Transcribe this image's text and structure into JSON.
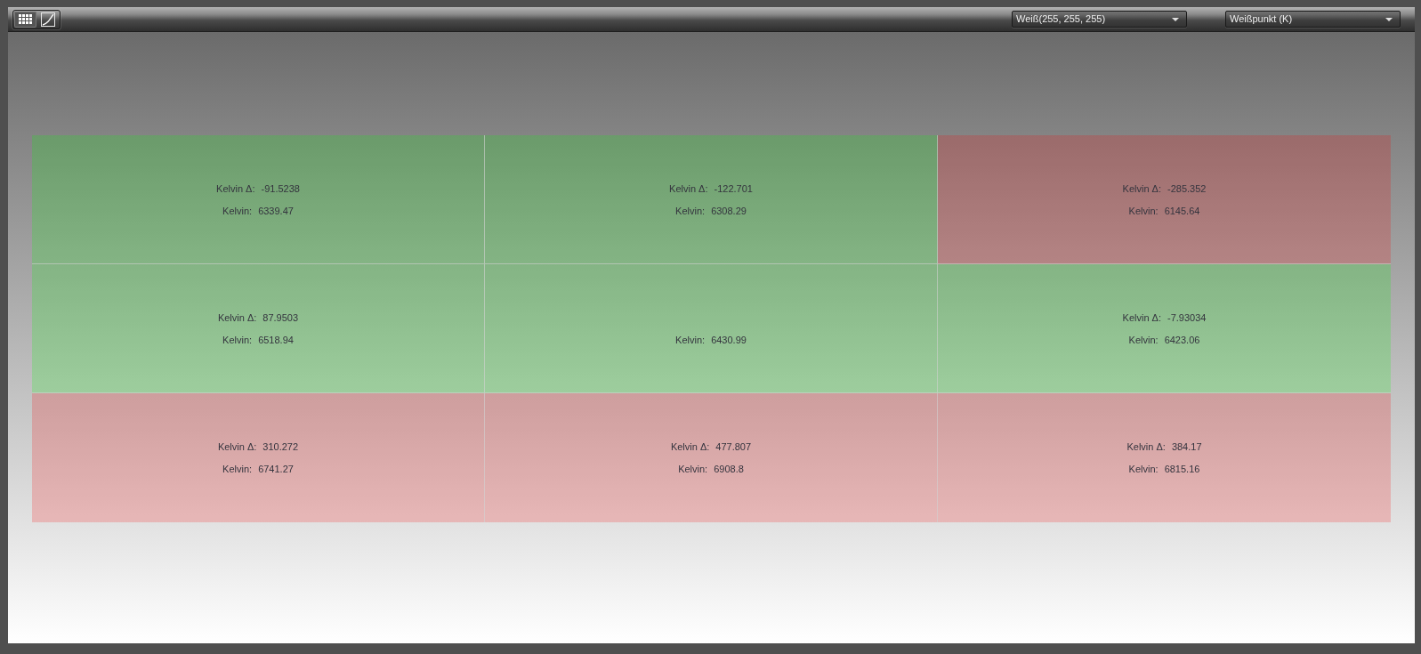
{
  "toolbar": {
    "view_buttons": [
      {
        "kind": "grid",
        "selected": true
      },
      {
        "kind": "curve",
        "selected": false
      }
    ],
    "dropdowns": [
      {
        "value": "Weiß(255, 255, 255)"
      },
      {
        "value": "Weißpunkt (K)"
      }
    ]
  },
  "grid": {
    "rows": [
      [
        {
          "delta_label": "Kelvin Δ:",
          "delta": "-91.5238",
          "kelvin_label": "Kelvin:",
          "kelvin": "6339.47",
          "in_tolerance": true
        },
        {
          "delta_label": "Kelvin Δ:",
          "delta": "-122.701",
          "kelvin_label": "Kelvin:",
          "kelvin": "6308.29",
          "in_tolerance": true
        },
        {
          "delta_label": "Kelvin Δ:",
          "delta": "-285.352",
          "kelvin_label": "Kelvin:",
          "kelvin": "6145.64",
          "in_tolerance": false
        }
      ],
      [
        {
          "delta_label": "Kelvin Δ:",
          "delta": "87.9503",
          "kelvin_label": "Kelvin:",
          "kelvin": "6518.94",
          "in_tolerance": true
        },
        {
          "kelvin_label": "Kelvin:",
          "kelvin": "6430.99",
          "in_tolerance": true
        },
        {
          "delta_label": "Kelvin Δ:",
          "delta": "-7.93034",
          "kelvin_label": "Kelvin:",
          "kelvin": "6423.06",
          "in_tolerance": true
        }
      ],
      [
        {
          "delta_label": "Kelvin Δ:",
          "delta": "310.272",
          "kelvin_label": "Kelvin:",
          "kelvin": "6741.27",
          "in_tolerance": false
        },
        {
          "delta_label": "Kelvin Δ:",
          "delta": "477.807",
          "kelvin_label": "Kelvin:",
          "kelvin": "6908.8",
          "in_tolerance": false
        },
        {
          "delta_label": "Kelvin Δ:",
          "delta": "384.17",
          "kelvin_label": "Kelvin:",
          "kelvin": "6815.16",
          "in_tolerance": false
        }
      ]
    ]
  }
}
